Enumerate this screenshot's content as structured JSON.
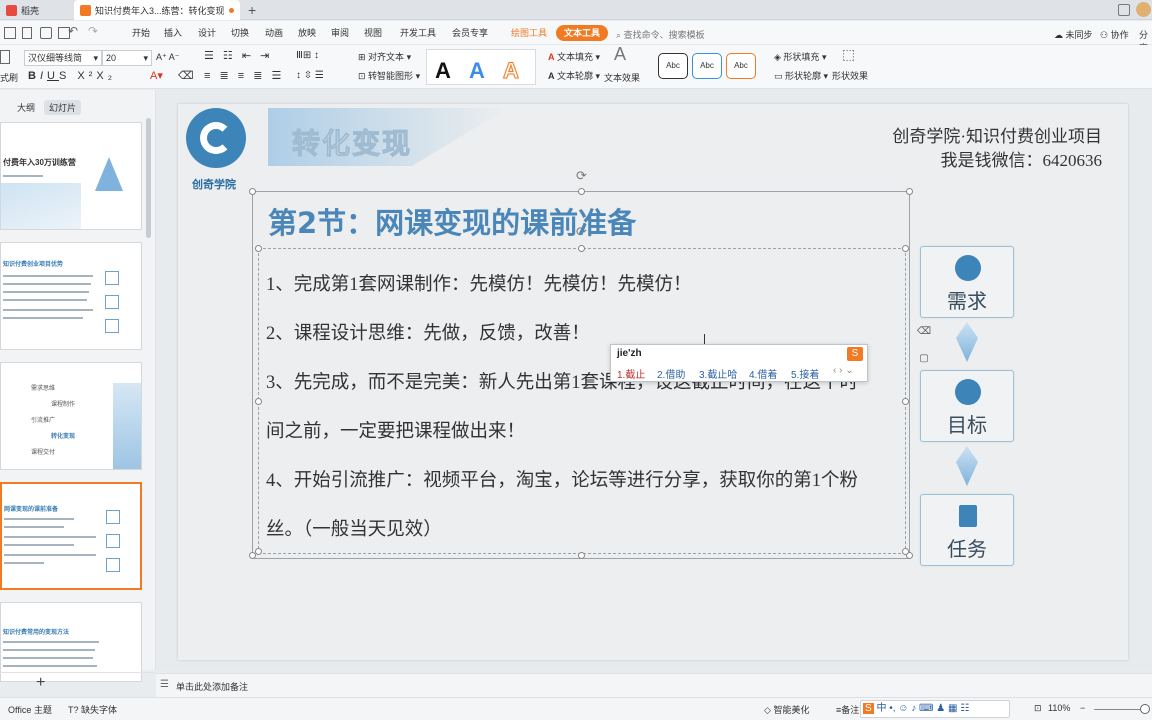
{
  "tabs": [
    {
      "label": "稻壳"
    },
    {
      "label": "知识付费年入3...练营：转化变现"
    }
  ],
  "menu": {
    "items": [
      "开始",
      "插入",
      "设计",
      "切换",
      "动画",
      "放映",
      "审阅",
      "视图",
      "开发工具",
      "会员专享"
    ],
    "drawing_tools": "绘图工具",
    "text_tools": "文本工具",
    "search_placeholder": "查找命令、搜索模板",
    "sync": "未同步",
    "collab": "协作",
    "share": "分享"
  },
  "ribbon": {
    "font_name": "汉仪细等线简",
    "font_size": "20",
    "align_text": "对齐文本",
    "smart_shape": "转智能图形",
    "text_fill": "文本填充",
    "text_outline": "文本轮廓",
    "text_effect": "文本效果",
    "style_sample": "Abc",
    "shape_fill": "形状填充",
    "shape_outline": "形状轮廓",
    "shape_effect": "形状效果",
    "format_painter": "式刷"
  },
  "sidebar": {
    "tab_outline": "大纲",
    "tab_slides": "幻灯片",
    "thumb1_title": "付费年入30万训练营",
    "thumb2_title": "知识付费创业项目优势",
    "thumb3_items": [
      "需求思维",
      "课程制作",
      "引流推广",
      "转化变现",
      "课程交付"
    ],
    "thumb4_title": "网课变现的课前准备",
    "thumb5_title": "知识付费常用的变现方法"
  },
  "slide": {
    "logo_text": "创奇学院",
    "header_title": "转化变现",
    "org_line": "创奇学院·知识付费创业项目",
    "wechat_line": "我是钱微信：6420636",
    "section_title": "第2节：网课变现的课前准备",
    "points": [
      "1、完成第1套网课制作：先模仿！先模仿！先模仿！",
      "2、课程设计思维：先做，反馈，改善！",
      "3、先完成，而不是完美：新人先出第1套课程，设这截止时间，在这个时",
      "间之前，一定要把课程做出来！",
      "4、开始引流推广：视频平台，淘宝，论坛等进行分享，获取你的第1个粉",
      "丝。（一般当天见效）"
    ],
    "cards": [
      "需求",
      "目标",
      "任务"
    ]
  },
  "ime": {
    "input": "jie'zh",
    "candidates": [
      "1.截止",
      "2.借助",
      "3.截止哈",
      "4.借着",
      "5.接着"
    ]
  },
  "notes_placeholder": "单击此处添加备注",
  "status": {
    "theme": "Office 主题",
    "missing_font": "缺失字体",
    "smart_beautify": "智能美化",
    "notes": "备注",
    "zoom": "110%"
  },
  "colors": {
    "accent_orange": "#f07b24",
    "title_blue": "#4a86b8",
    "card_blue": "#3d84b8"
  }
}
